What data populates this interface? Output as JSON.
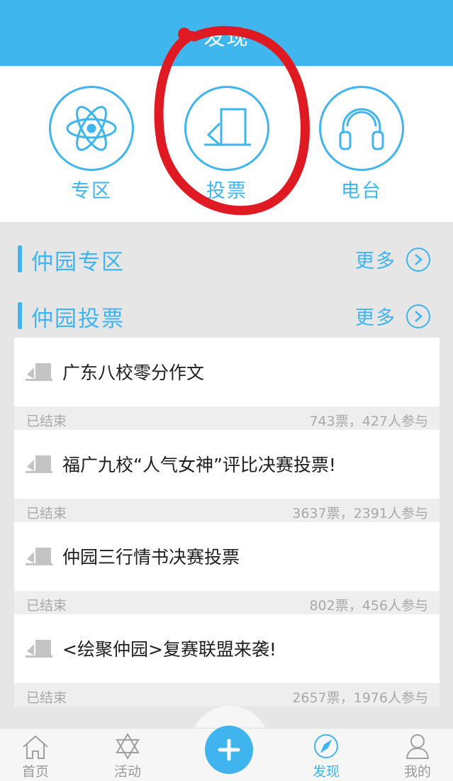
{
  "header": {
    "title": "发现"
  },
  "categories": [
    {
      "label": "专区",
      "icon": "atom-icon"
    },
    {
      "label": "投票",
      "icon": "ballot-box-icon"
    },
    {
      "label": "电台",
      "icon": "headphones-icon"
    }
  ],
  "sections": {
    "zone": {
      "title": "仲园专区",
      "more_label": "更多"
    },
    "vote": {
      "title": "仲园投票",
      "more_label": "更多"
    }
  },
  "votes": [
    {
      "title": "广东八校零分作文",
      "status": "已结束",
      "stats": "743票，427人参与"
    },
    {
      "title": "福广九校“人气女神”评比决赛投票!",
      "status": "已结束",
      "stats": "3637票，2391人参与"
    },
    {
      "title": "仲园三行情书决赛投票",
      "status": "已结束",
      "stats": "802票，456人参与"
    },
    {
      "title": "<绘聚仲园>复赛联盟来袭!",
      "status": "已结束",
      "stats": "2657票，1976人参与"
    }
  ],
  "tabbar": {
    "home": "首页",
    "activity": "活动",
    "discover": "发现",
    "mine": "我的",
    "active_tab": "发现"
  },
  "colors": {
    "accent": "#3fb4ee",
    "header": "#40b6ef",
    "annotation": "#e01a22"
  }
}
